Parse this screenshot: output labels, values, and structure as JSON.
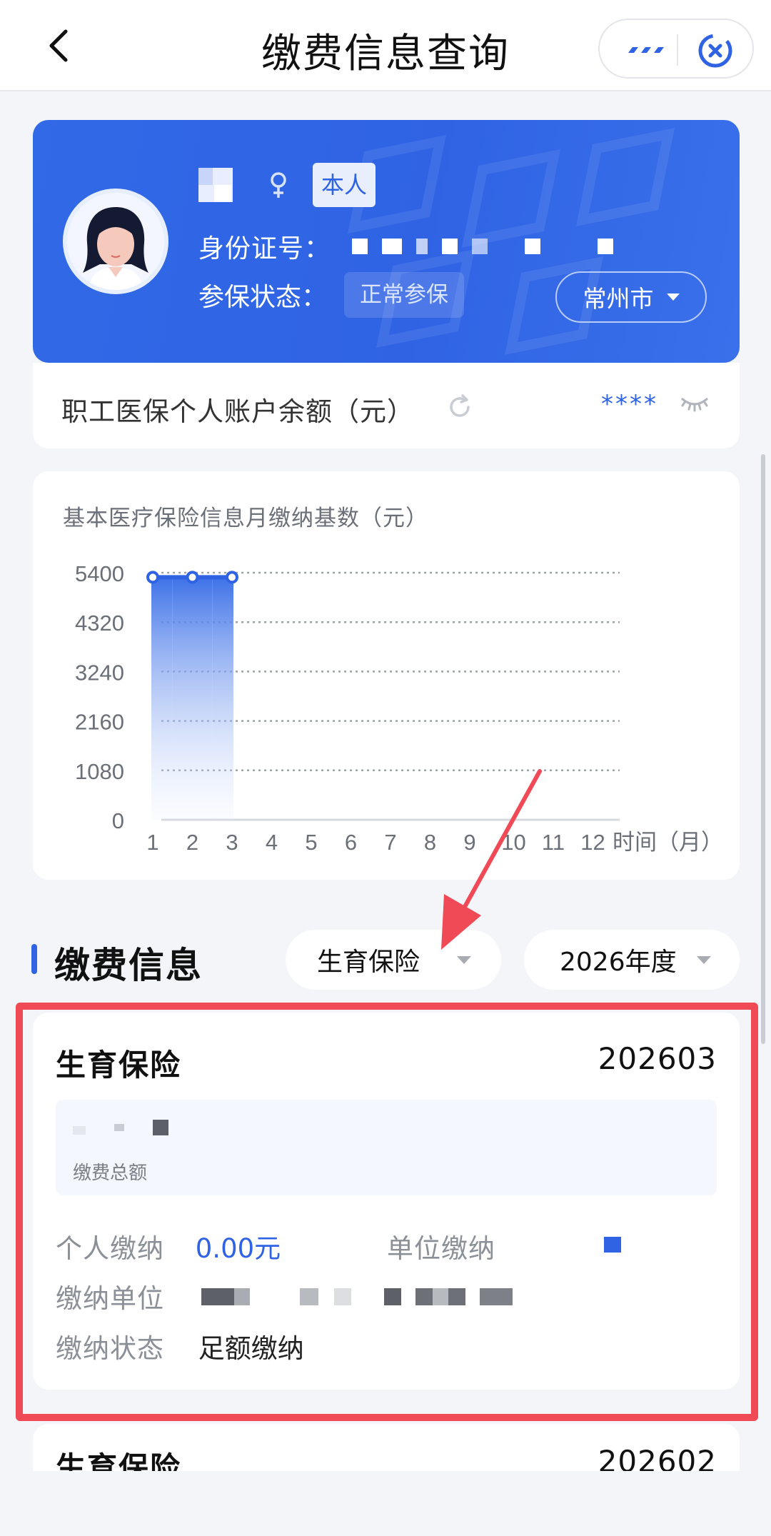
{
  "header": {
    "title": "缴费信息查询",
    "back_icon": "chevron-left-icon",
    "more_icon": "more-dots-icon",
    "close_icon": "close-circle-icon"
  },
  "profile": {
    "gender_icon": "female-icon",
    "relation_badge": "本人",
    "id_label": "身份证号：",
    "status_label": "参保状态：",
    "status_value": "正常参保",
    "city": "常州市",
    "colors": {
      "card": "#2f63e4",
      "accent": "#2f63e4"
    }
  },
  "balance": {
    "label": "职工医保个人账户余额（元）",
    "value_masked": "****",
    "refresh_icon": "refresh-icon",
    "eye_icon": "eye-closed-icon"
  },
  "chart": {
    "title": "基本医疗保险信息月缴纳基数（元）",
    "x_axis_label": "时间（月）"
  },
  "chart_data": {
    "type": "bar",
    "title": "基本医疗保险信息月缴纳基数（元）",
    "xlabel": "时间（月）",
    "ylabel": "",
    "categories": [
      "1",
      "2",
      "3",
      "4",
      "5",
      "6",
      "7",
      "8",
      "9",
      "10",
      "11",
      "12"
    ],
    "values": [
      5300,
      5300,
      5300,
      null,
      null,
      null,
      null,
      null,
      null,
      null,
      null,
      null
    ],
    "y_ticks": [
      0,
      1080,
      2160,
      3240,
      4320,
      5400
    ],
    "ylim": [
      0,
      5400
    ],
    "grid": true
  },
  "section": {
    "title": "缴费信息",
    "type_dropdown": "生育保险",
    "year_dropdown": "2026年度"
  },
  "payment": {
    "type": "生育保险",
    "period": "202603",
    "total_caption": "缴费总额",
    "personal_label": "个人缴纳",
    "personal_value": "0.00元",
    "employer_label": "单位缴纳",
    "unit_label": "缴纳单位",
    "status_label": "缴纳状态",
    "status_value": "足额缴纳"
  },
  "next_payment": {
    "type": "生育保险",
    "period": "202602"
  }
}
